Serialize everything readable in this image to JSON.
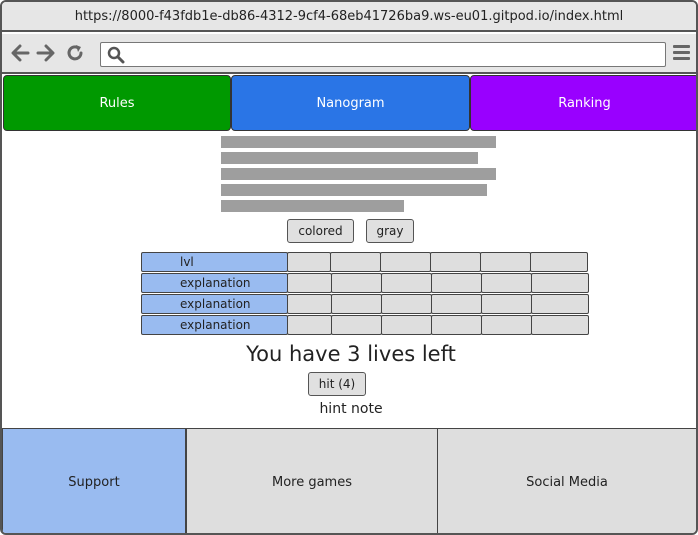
{
  "browser": {
    "url": "https://8000-f43fdb1e-db86-4312-9cf4-68eb41726ba9.ws-eu01.gitpod.io/index.html",
    "search_value": "",
    "icons": [
      "back-arrow-icon",
      "forward-arrow-icon",
      "reload-icon",
      "search-icon",
      "hamburger-menu-icon"
    ]
  },
  "tabs": [
    {
      "label": "Rules",
      "color": "#009900"
    },
    {
      "label": "Nanogram",
      "color": "#2a75e6"
    },
    {
      "label": "Ranking",
      "color": "#9900ff"
    }
  ],
  "mode_buttons": {
    "colored": "colored",
    "gray": "gray"
  },
  "table": {
    "rows": [
      {
        "label": "lvl"
      },
      {
        "label": "explanation"
      },
      {
        "label": "explanation"
      },
      {
        "label": "explanation"
      }
    ],
    "label_color": "#99bbf0",
    "cell_color": "#dedede"
  },
  "status": {
    "lives_text": "You have 3 lives left",
    "hit_label": "hit (4)",
    "hint_text": "hint note"
  },
  "footer": {
    "support": "Support",
    "more_games": "More games",
    "social_media": "Social Media",
    "support_color": "#99bbf0",
    "box_color": "#dedede"
  }
}
